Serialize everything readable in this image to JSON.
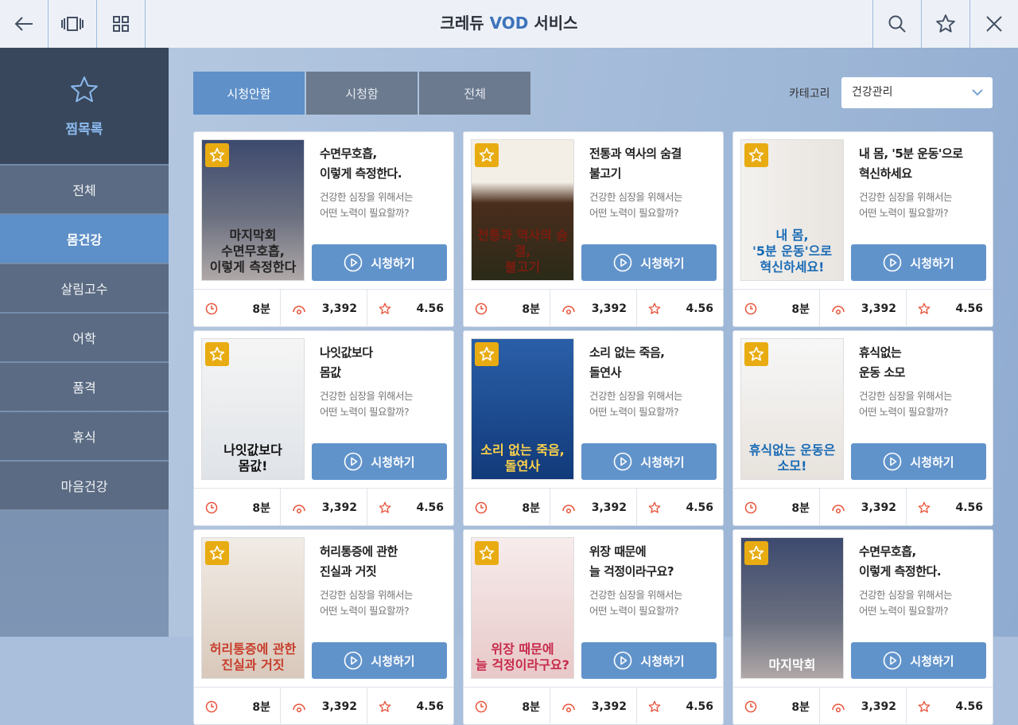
{
  "header": {
    "title_prefix": "크레듀 ",
    "title_accent": "VOD",
    "title_suffix": " 서비스"
  },
  "sidebar": {
    "favorites_label": "찜목록",
    "items": [
      {
        "label": "전체",
        "active": false
      },
      {
        "label": "몸건강",
        "active": true
      },
      {
        "label": "살림고수",
        "active": false
      },
      {
        "label": "어학",
        "active": false
      },
      {
        "label": "품격",
        "active": false
      },
      {
        "label": "휴식",
        "active": false
      },
      {
        "label": "마음건강",
        "active": false
      }
    ]
  },
  "tabs": [
    {
      "label": "시청안함",
      "active": true
    },
    {
      "label": "시청함",
      "active": false
    },
    {
      "label": "전체",
      "active": false
    }
  ],
  "category": {
    "label": "카테고리",
    "value": "건강관리"
  },
  "colors": {
    "accent": "#5f90c8",
    "favorite": "#e8ac12",
    "stat_icon": "#e8533a"
  },
  "cards": [
    {
      "title": "수면무호흡,\n이렇게 측정한다.",
      "desc": "건강한 심장을 위해서는\n어떤 노력이 필요할까?",
      "thumb_text": "마지막회\n수면무호흡,\n이렇게 측정한다",
      "play": "시청하기",
      "duration": "8분",
      "views": "3,392",
      "rating": "4.56"
    },
    {
      "title": "전통과 역사의 숨결\n불고기",
      "desc": "건강한 심장을 위해서는\n어떤 노력이 필요할까?",
      "thumb_text": "전통과 역사의 숨결,\n불고기",
      "play": "시청하기",
      "duration": "8분",
      "views": "3,392",
      "rating": "4.56"
    },
    {
      "title": "내 몸, '5분 운동'으로\n혁신하세요",
      "desc": "건강한 심장을 위해서는\n어떤 노력이 필요할까?",
      "thumb_text": "내 몸,\n'5분 운동'으로\n혁신하세요!",
      "play": "시청하기",
      "duration": "8분",
      "views": "3,392",
      "rating": "4.56"
    },
    {
      "title": "나잇값보다\n몸값",
      "desc": "건강한 심장을 위해서는\n어떤 노력이 필요할까?",
      "thumb_text": "나잇값보다\n몸값!",
      "play": "시청하기",
      "duration": "8분",
      "views": "3,392",
      "rating": "4.56"
    },
    {
      "title": "소리 없는 죽음,\n돌연사",
      "desc": "건강한 심장을 위해서는\n어떤 노력이 필요할까?",
      "thumb_text": "소리 없는 죽음,\n돌연사",
      "play": "시청하기",
      "duration": "8분",
      "views": "3,392",
      "rating": "4.56"
    },
    {
      "title": "휴식없는\n운동 소모",
      "desc": "건강한 심장을 위해서는\n어떤 노력이 필요할까?",
      "thumb_text": "휴식없는 운동은\n소모!",
      "play": "시청하기",
      "duration": "8분",
      "views": "3,392",
      "rating": "4.56"
    },
    {
      "title": "허리통증에 관한\n진실과 거짓",
      "desc": "건강한 심장을 위해서는\n어떤 노력이 필요할까?",
      "thumb_text": "허리통증에 관한\n진실과 거짓",
      "play": "시청하기",
      "duration": "8분",
      "views": "3,392",
      "rating": "4.56"
    },
    {
      "title": "위장 때문에\n늘 걱정이라구요?",
      "desc": "건강한 심장을 위해서는\n어떤 노력이 필요할까?",
      "thumb_text": "위장 때문에\n늘 걱정이라구요?",
      "play": "시청하기",
      "duration": "8분",
      "views": "3,392",
      "rating": "4.56"
    },
    {
      "title": "수면무호흡,\n이렇게 측정한다.",
      "desc": "건강한 심장을 위해서는\n어떤 노력이 필요할까?",
      "thumb_text": "마지막회",
      "play": "시청하기",
      "duration": "8분",
      "views": "3,392",
      "rating": "4.56"
    }
  ]
}
